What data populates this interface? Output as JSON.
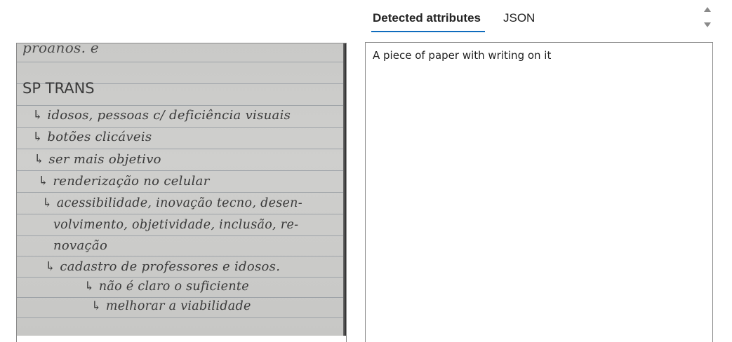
{
  "tabs": [
    {
      "label": "Detected attributes",
      "active": true
    },
    {
      "label": "JSON",
      "active": false
    }
  ],
  "result": {
    "text": "A piece of paper with writing on it"
  },
  "image": {
    "lines": [
      "proanos. e",
      "SP TRANS",
      "↳ idosos, pessoas c/ deficiência visuais",
      "↳ botões clicáveis",
      "↳ ser mais objetivo",
      "↳ renderização no celular",
      "↳ acessibilidade, inovação tecno, desen-",
      "volvimento, objetividade, inclusão, re-",
      "novação",
      "↳ cadastro de professores e idosos.",
      "↳ não é claro o suficiente",
      "↳ melhorar a viabilidade"
    ]
  },
  "colors": {
    "accent": "#0f6cbd",
    "border": "#8a8a8a",
    "paper": "#cbcbc9",
    "ink": "#3a3a3a"
  },
  "icons": {
    "scroll_up": "chevron-up-icon",
    "scroll_down": "chevron-down-icon"
  }
}
